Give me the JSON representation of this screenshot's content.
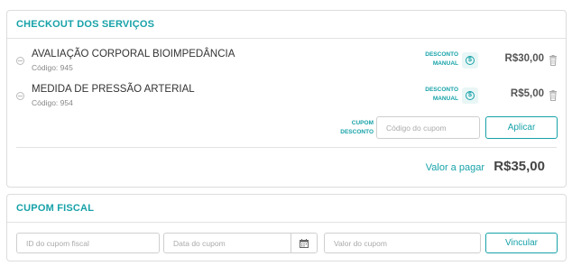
{
  "checkout": {
    "title": "CHECKOUT DOS SERVIÇOS",
    "items": [
      {
        "name": "AVALIAÇÃO CORPORAL BIOIMPEDÂNCIA",
        "code": "Código: 945",
        "discount_label_1": "DESCONTO",
        "discount_label_2": "MANUAL",
        "price": "R$30,00"
      },
      {
        "name": "MEDIDA DE PRESSÃO ARTERIAL",
        "code": "Código: 954",
        "discount_label_1": "DESCONTO",
        "discount_label_2": "MANUAL",
        "price": "R$5,00"
      }
    ],
    "coupon": {
      "label_1": "CUPOM",
      "label_2": "DESCONTO",
      "placeholder": "Código do cupom",
      "button": "Aplicar"
    },
    "total_label": "Valor a pagar",
    "total_value": "R$35,00"
  },
  "fiscal": {
    "title": "CUPOM FISCAL",
    "id_placeholder": "ID do cupom fiscal",
    "date_placeholder": "Data do cupom",
    "value_placeholder": "Valor do cupom",
    "button": "Vincular"
  },
  "colors": {
    "accent": "#17a2a8",
    "border": "#dcdcdc"
  },
  "icons": {
    "discount": "coin-icon",
    "remove": "trash-icon",
    "bullet": "minus-circle-icon",
    "date": "calendar-icon"
  }
}
